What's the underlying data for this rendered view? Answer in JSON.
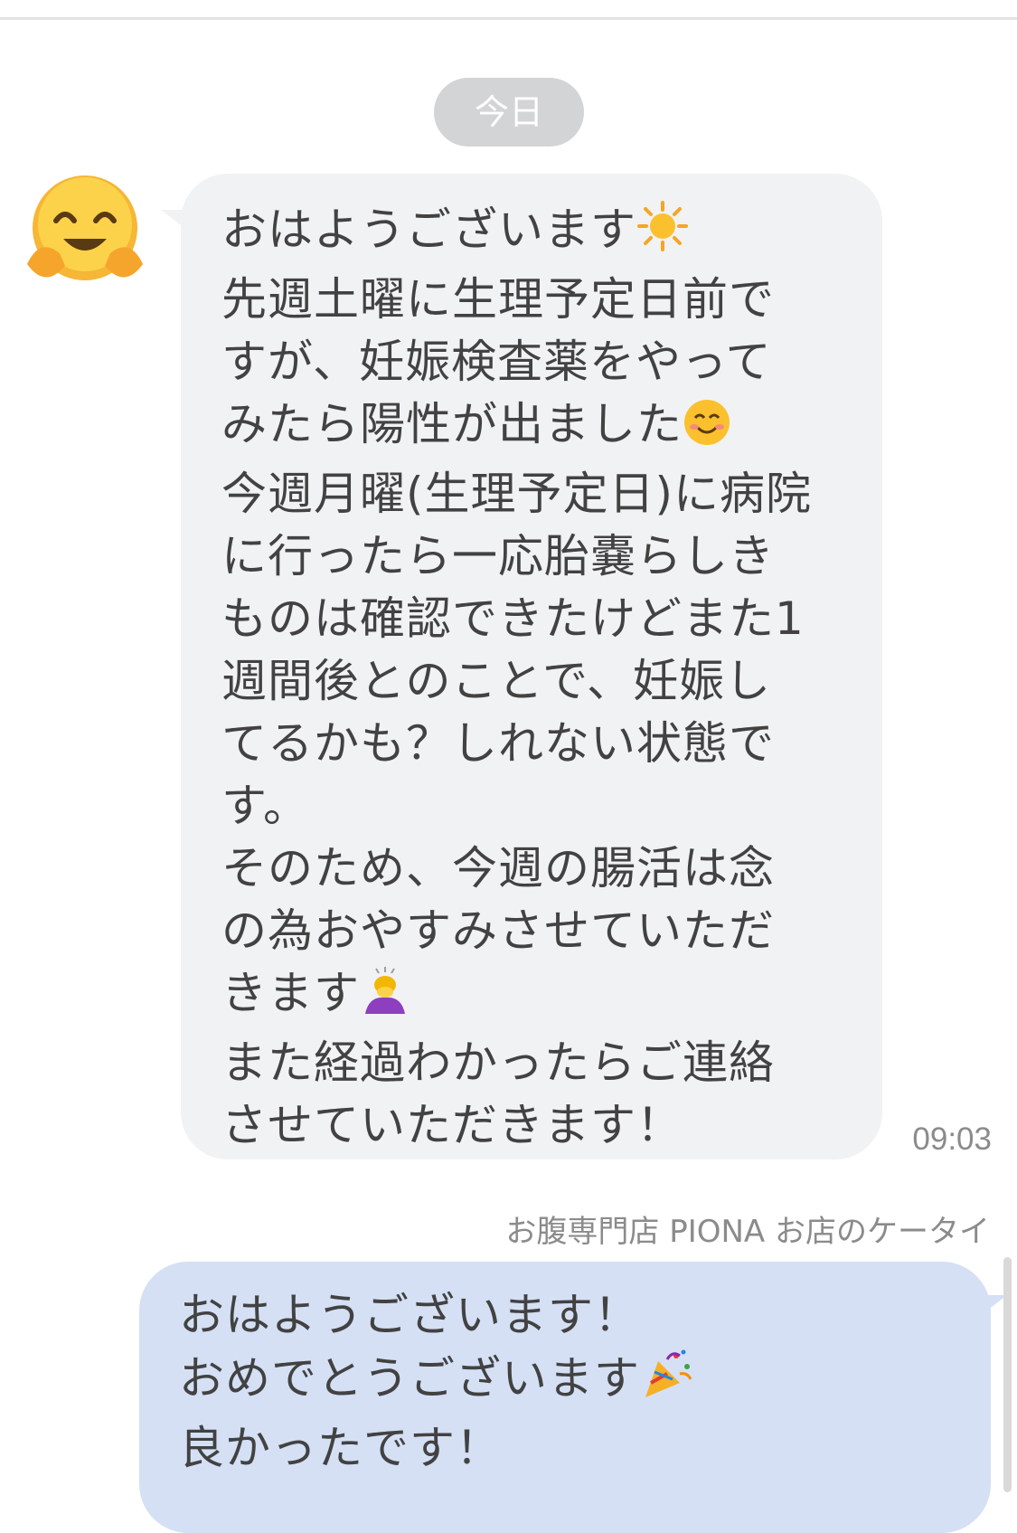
{
  "date_chip": "今日",
  "incoming": {
    "lines": [
      "おはようございます",
      "先週土曜に生理予定日前で",
      "すが、妊娠検査薬をやって",
      "みたら陽性が出ました",
      "今週月曜(生理予定日)に病院",
      "に行ったら一応胎嚢らしき",
      "ものは確認できたけどまた1",
      "週間後とのことで、妊娠し",
      "てるかも？しれない状態で",
      "す。",
      "そのため、今週の腸活は念",
      "の為おやすみさせていただ",
      "きます",
      "また経過わかったらご連絡",
      "させていただきます！"
    ],
    "emojis": [
      "sun-emoji",
      "smiling-face-emoji",
      "bowing-person-emoji"
    ],
    "time": "09:03"
  },
  "outgoing": {
    "sender": "お腹専門店  PIONA お店のケータイ",
    "lines": [
      "おはようございます！",
      "おめでとうございます",
      "良かったです！"
    ],
    "emojis": [
      "party-popper-emoji"
    ]
  },
  "colors": {
    "incoming_bubble": "#f1f2f4",
    "outgoing_bubble": "#d5e0f5",
    "date_chip": "#d3d4d6",
    "text": "#424242",
    "meta_text": "#8b8b8b"
  },
  "icons": {
    "avatar": "hugging-face-icon"
  }
}
